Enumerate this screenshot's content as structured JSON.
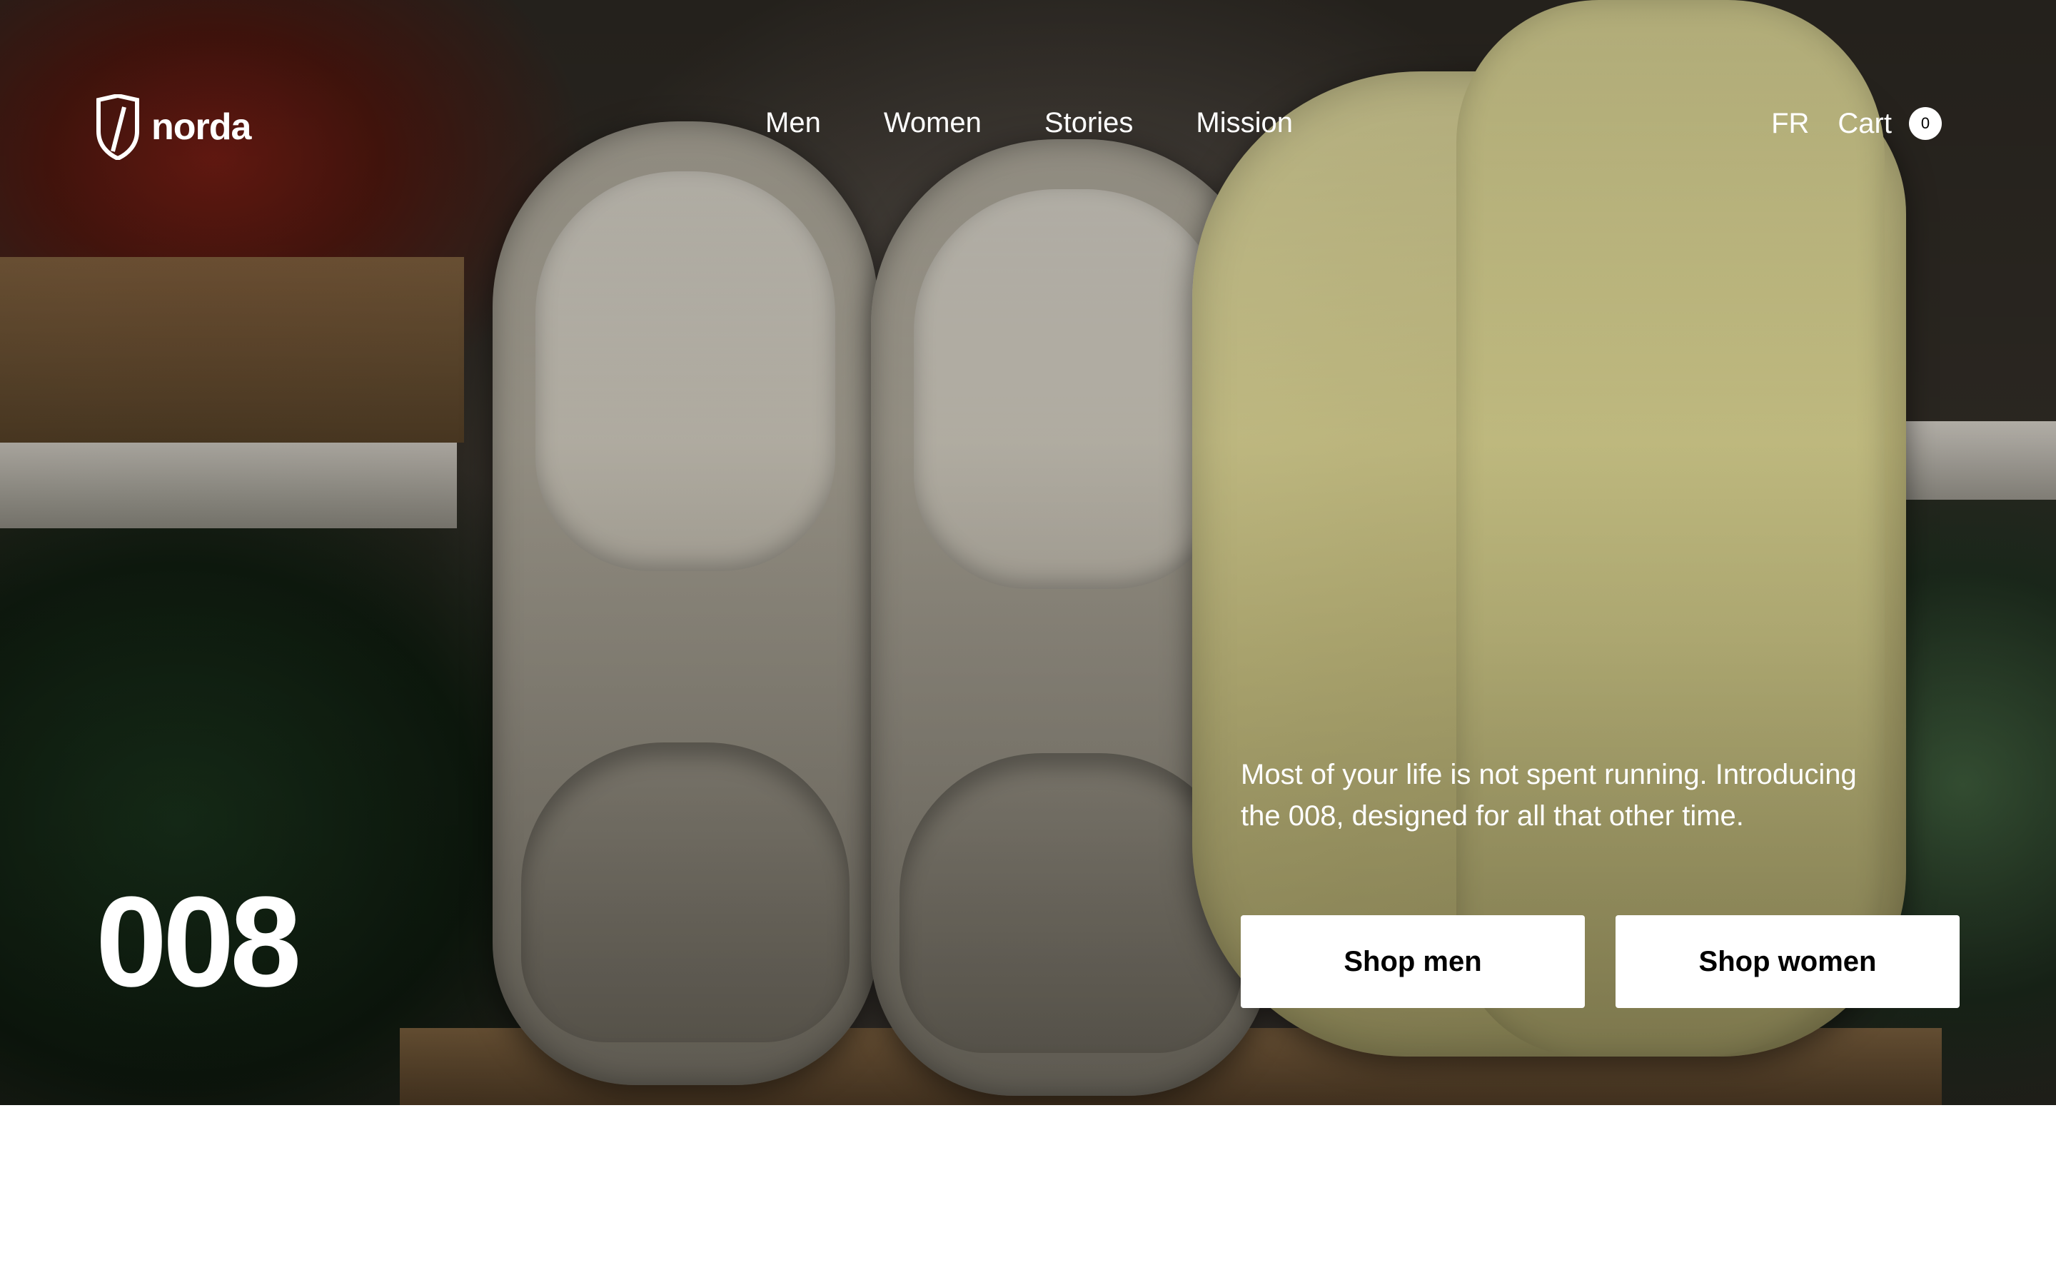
{
  "brand": {
    "name": "norda"
  },
  "nav": {
    "items": [
      {
        "label": "Men"
      },
      {
        "label": "Women"
      },
      {
        "label": "Stories"
      },
      {
        "label": "Mission"
      }
    ]
  },
  "header": {
    "language": "FR",
    "cart_label": "Cart",
    "cart_count": "0"
  },
  "hero": {
    "product_number": "008",
    "tagline": "Most of your life is not spent running. Introducing the 008, designed for all that other time.",
    "cta_men": "Shop men",
    "cta_women": "Shop women"
  },
  "colors": {
    "accent_text": "#ffffff",
    "button_bg": "#ffffff",
    "button_text": "#000000"
  }
}
